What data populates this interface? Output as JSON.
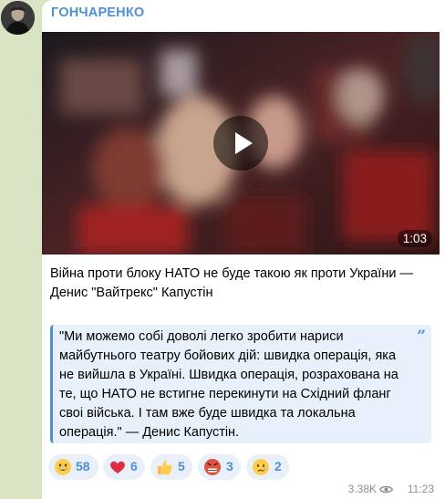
{
  "channel": {
    "name": "ГОНЧАРЕНКО",
    "avatar_icon": "avatar-photo"
  },
  "video": {
    "duration": "1:03",
    "play_icon": "play-icon"
  },
  "message": {
    "caption": "Війна проти блоку НАТО не буде такою як проти України — Денис \"Вайтрекс\" Капустін",
    "quote": "\"Ми можемо собі доволі легко зробити нариси майбутнього театру бойових дій: швидка операція, яка не вийшла в Україні. Швидка операція, розрахована на те, що НАТО не встигне перекинути на Східний фланг своі війська. І там вже буде швидка та локальна операція.\" — Денис Капустін.",
    "quote_mark": "”"
  },
  "reactions": [
    {
      "emoji": "grinning-face-icon",
      "count": "58"
    },
    {
      "emoji": "red-heart-icon",
      "count": "6"
    },
    {
      "emoji": "thumbs-up-icon",
      "count": "5"
    },
    {
      "emoji": "angry-face-icon",
      "count": "3"
    },
    {
      "emoji": "crying-face-icon",
      "count": "2"
    }
  ],
  "meta": {
    "views": "3.38K",
    "time": "11:23",
    "views_icon": "eye-icon"
  },
  "colors": {
    "background": "#d9e4c4",
    "accent": "#4f8fd6",
    "bubble": "#ffffff",
    "quote_bg": "#e8f1fb"
  }
}
